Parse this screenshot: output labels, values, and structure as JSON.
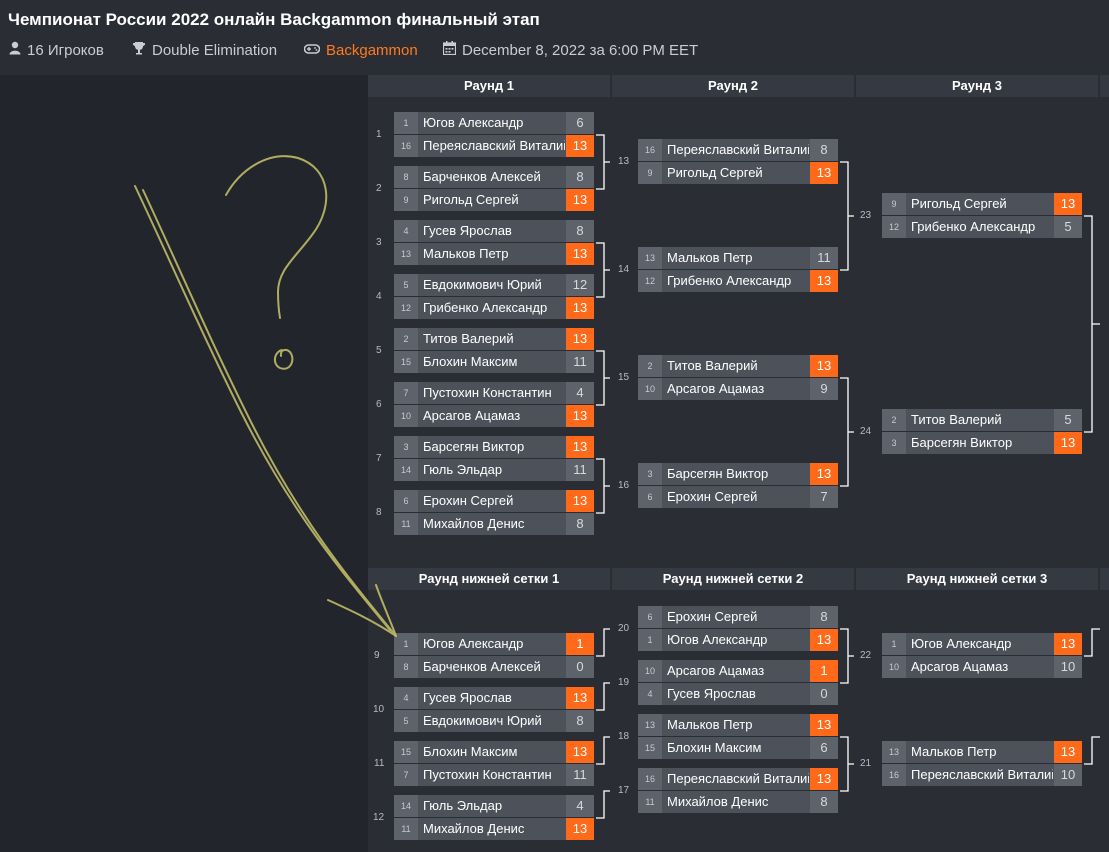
{
  "header": {
    "title": "Чемпионат России 2022 онлайн Backgammon финальный этап",
    "players": "16 Игроков",
    "format": "Double Elimination",
    "game": "Backgammon",
    "date": "December 8, 2022 за 6:00 PM EET"
  },
  "upper": {
    "headers": [
      "Раунд 1",
      "Раунд 2",
      "Раунд 3"
    ],
    "matches": [
      {
        "id": "1",
        "label": "1",
        "p": [
          {
            "seed": "1",
            "name": "Югов Александр",
            "score": "6",
            "win": false
          },
          {
            "seed": "16",
            "name": "Переяславский Виталий",
            "score": "13",
            "win": true
          }
        ]
      },
      {
        "id": "2",
        "label": "2",
        "p": [
          {
            "seed": "8",
            "name": "Барченков Алексей",
            "score": "8",
            "win": false
          },
          {
            "seed": "9",
            "name": "Ригольд Сергей",
            "score": "13",
            "win": true
          }
        ]
      },
      {
        "id": "3",
        "label": "3",
        "p": [
          {
            "seed": "4",
            "name": "Гусев Ярослав",
            "score": "8",
            "win": false
          },
          {
            "seed": "13",
            "name": "Мальков Петр",
            "score": "13",
            "win": true
          }
        ]
      },
      {
        "id": "4",
        "label": "4",
        "p": [
          {
            "seed": "5",
            "name": "Евдокимович Юрий",
            "score": "12",
            "win": false
          },
          {
            "seed": "12",
            "name": "Грибенко Александр",
            "score": "13",
            "win": true
          }
        ]
      },
      {
        "id": "5",
        "label": "5",
        "p": [
          {
            "seed": "2",
            "name": "Титов Валерий",
            "score": "13",
            "win": true
          },
          {
            "seed": "15",
            "name": "Блохин Максим",
            "score": "11",
            "win": false
          }
        ]
      },
      {
        "id": "6",
        "label": "6",
        "p": [
          {
            "seed": "7",
            "name": "Пустохин Константин",
            "score": "4",
            "win": false
          },
          {
            "seed": "10",
            "name": "Арсагов Ацамаз",
            "score": "13",
            "win": true
          }
        ]
      },
      {
        "id": "7",
        "label": "7",
        "p": [
          {
            "seed": "3",
            "name": "Барсегян Виктор",
            "score": "13",
            "win": true
          },
          {
            "seed": "14",
            "name": "Гюль Эльдар",
            "score": "11",
            "win": false
          }
        ]
      },
      {
        "id": "8",
        "label": "8",
        "p": [
          {
            "seed": "6",
            "name": "Ерохин Сергей",
            "score": "13",
            "win": true
          },
          {
            "seed": "11",
            "name": "Михайлов Денис",
            "score": "8",
            "win": false
          }
        ]
      },
      {
        "id": "13",
        "label": "13",
        "p": [
          {
            "seed": "16",
            "name": "Переяславский Виталий",
            "score": "8",
            "win": false
          },
          {
            "seed": "9",
            "name": "Ригольд Сергей",
            "score": "13",
            "win": true
          }
        ]
      },
      {
        "id": "14",
        "label": "14",
        "p": [
          {
            "seed": "13",
            "name": "Мальков Петр",
            "score": "11",
            "win": false
          },
          {
            "seed": "12",
            "name": "Грибенко Александр",
            "score": "13",
            "win": true
          }
        ]
      },
      {
        "id": "15",
        "label": "15",
        "p": [
          {
            "seed": "2",
            "name": "Титов Валерий",
            "score": "13",
            "win": true
          },
          {
            "seed": "10",
            "name": "Арсагов Ацамаз",
            "score": "9",
            "win": false
          }
        ]
      },
      {
        "id": "16",
        "label": "16",
        "p": [
          {
            "seed": "3",
            "name": "Барсегян Виктор",
            "score": "13",
            "win": true
          },
          {
            "seed": "6",
            "name": "Ерохин Сергей",
            "score": "7",
            "win": false
          }
        ]
      },
      {
        "id": "23",
        "label": "23",
        "p": [
          {
            "seed": "9",
            "name": "Ригольд Сергей",
            "score": "13",
            "win": true
          },
          {
            "seed": "12",
            "name": "Грибенко Александр",
            "score": "5",
            "win": false
          }
        ]
      },
      {
        "id": "24",
        "label": "24",
        "p": [
          {
            "seed": "2",
            "name": "Титов Валерий",
            "score": "5",
            "win": false
          },
          {
            "seed": "3",
            "name": "Барсегян Виктор",
            "score": "13",
            "win": true
          }
        ]
      }
    ]
  },
  "lower": {
    "headers": [
      "Раунд нижней сетки 1",
      "Раунд нижней сетки 2",
      "Раунд нижней сетки 3"
    ],
    "matches": [
      {
        "id": "9",
        "label": "9",
        "p": [
          {
            "seed": "1",
            "name": "Югов Александр",
            "score": "1",
            "win": true
          },
          {
            "seed": "8",
            "name": "Барченков Алексей",
            "score": "0",
            "win": false
          }
        ]
      },
      {
        "id": "10",
        "label": "10",
        "p": [
          {
            "seed": "4",
            "name": "Гусев Ярослав",
            "score": "13",
            "win": true
          },
          {
            "seed": "5",
            "name": "Евдокимович Юрий",
            "score": "8",
            "win": false
          }
        ]
      },
      {
        "id": "11",
        "label": "11",
        "p": [
          {
            "seed": "15",
            "name": "Блохин Максим",
            "score": "13",
            "win": true
          },
          {
            "seed": "7",
            "name": "Пустохин Константин",
            "score": "11",
            "win": false
          }
        ]
      },
      {
        "id": "12",
        "label": "12",
        "p": [
          {
            "seed": "14",
            "name": "Гюль Эльдар",
            "score": "4",
            "win": false
          },
          {
            "seed": "11",
            "name": "Михайлов Денис",
            "score": "13",
            "win": true
          }
        ]
      },
      {
        "id": "20",
        "label": "20",
        "p": [
          {
            "seed": "6",
            "name": "Ерохин Сергей",
            "score": "8",
            "win": false
          },
          {
            "seed": "1",
            "name": "Югов Александр",
            "score": "13",
            "win": true
          }
        ]
      },
      {
        "id": "19",
        "label": "19",
        "p": [
          {
            "seed": "10",
            "name": "Арсагов Ацамаз",
            "score": "1",
            "win": true
          },
          {
            "seed": "4",
            "name": "Гусев Ярослав",
            "score": "0",
            "win": false
          }
        ]
      },
      {
        "id": "18",
        "label": "18",
        "p": [
          {
            "seed": "13",
            "name": "Мальков Петр",
            "score": "13",
            "win": true
          },
          {
            "seed": "15",
            "name": "Блохин Максим",
            "score": "6",
            "win": false
          }
        ]
      },
      {
        "id": "17",
        "label": "17",
        "p": [
          {
            "seed": "16",
            "name": "Переяславский Виталий",
            "score": "13",
            "win": true
          },
          {
            "seed": "11",
            "name": "Михайлов Денис",
            "score": "8",
            "win": false
          }
        ]
      },
      {
        "id": "22",
        "label": "22",
        "p": [
          {
            "seed": "1",
            "name": "Югов Александр",
            "score": "13",
            "win": true
          },
          {
            "seed": "10",
            "name": "Арсагов Ацамаз",
            "score": "10",
            "win": false
          }
        ]
      },
      {
        "id": "21",
        "label": "21",
        "p": [
          {
            "seed": "13",
            "name": "Мальков Петр",
            "score": "13",
            "win": true
          },
          {
            "seed": "16",
            "name": "Переяславский Виталий",
            "score": "10",
            "win": false
          }
        ]
      }
    ]
  },
  "colors": {
    "accent": "#ff6a1a",
    "link": "#ff7a1f",
    "bg": "#2a2d33",
    "annotation": "#c9c46a"
  },
  "icons": {
    "players": "user-icon",
    "format": "trophy-icon",
    "game": "gamepad-icon",
    "date": "calendar-icon"
  }
}
